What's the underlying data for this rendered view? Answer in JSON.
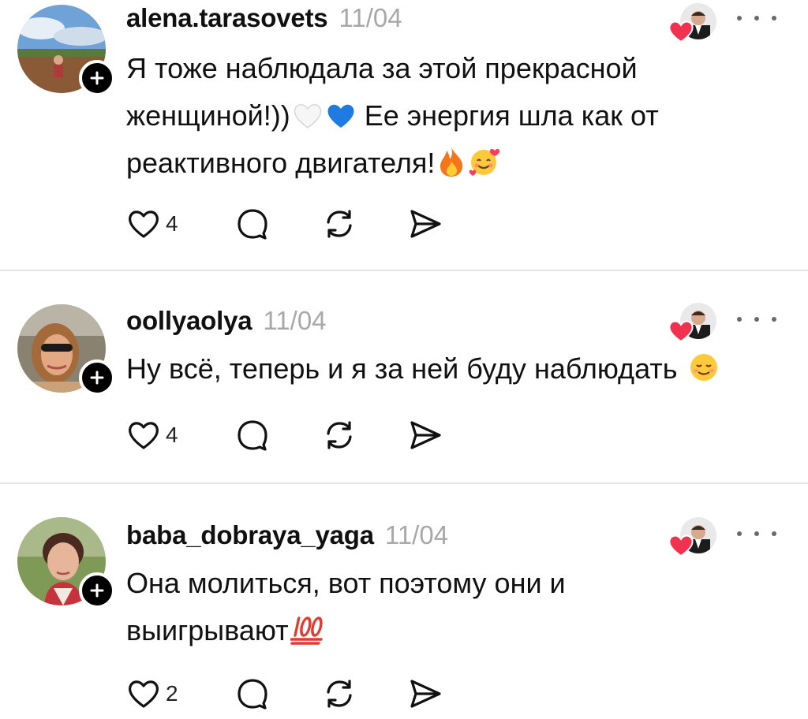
{
  "comments": [
    {
      "username": "alena.tarasovets",
      "date": "11/04",
      "lines": [
        "Я тоже наблюдала за этой прекрасной",
        "женщиной!))",
        "реактивного двигателя!"
      ],
      "line2_after_emoji": "Ее энергия шла как от",
      "emojis": [
        "white-heart",
        "blue-heart",
        "fire",
        "smiling-face-with-hearts"
      ],
      "likes": "4"
    },
    {
      "username": "oollyaolya",
      "date": "11/04",
      "lines": [
        "Ну всё, теперь и я за ней буду наблюдать"
      ],
      "emojis": [
        "smiling-face-blush"
      ],
      "likes": "4"
    },
    {
      "username": "baba_dobraya_yaga",
      "date": "11/04",
      "lines": [
        "Она молиться, вот поэтому они и",
        "выигрывают"
      ],
      "emojis": [
        "hundred-points"
      ],
      "likes": "2"
    }
  ],
  "colors": {
    "text": "#111111",
    "date": "#a8a8a8",
    "heart_badge": "#f2304f",
    "icon_stroke": "#111111",
    "divider": "#e6e6e6"
  }
}
